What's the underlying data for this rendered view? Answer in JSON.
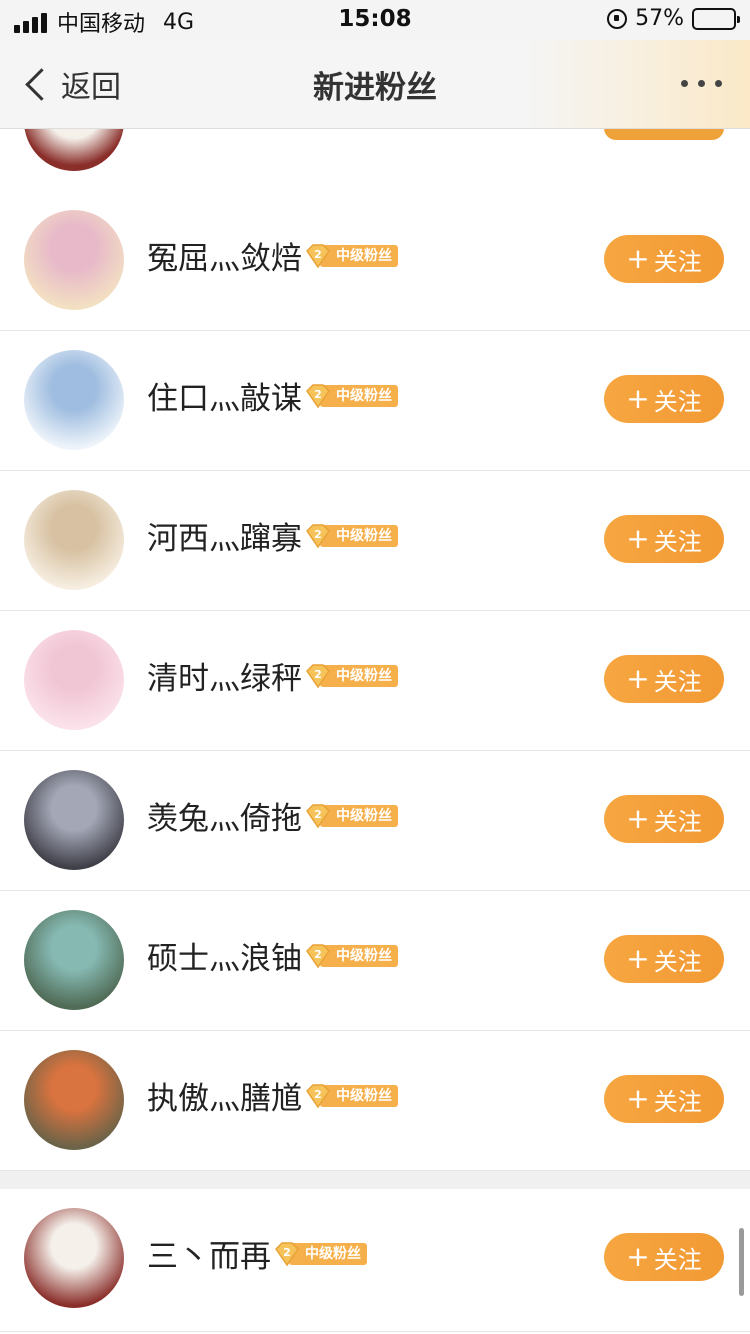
{
  "status_bar": {
    "carrier": "中国移动",
    "network": "4G",
    "time": "15:08",
    "battery": "57%",
    "battery_level": 0.57
  },
  "nav": {
    "back_label": "返回",
    "title": "新进粉丝",
    "more_icon": "more-icon"
  },
  "accent_color": "#f29a34",
  "badge": {
    "level": "2",
    "label": "中级粉丝"
  },
  "follow_label": "关注",
  "followers": [
    {
      "name": "冤屈灬敛焙",
      "avatar_colors": [
        "#f3e0c2",
        "#e7b9c9"
      ]
    },
    {
      "name": "住口灬敲谋",
      "avatar_colors": [
        "#eef4fa",
        "#9fbde0"
      ]
    },
    {
      "name": "河西灬蹿寡",
      "avatar_colors": [
        "#f6eee0",
        "#d7c1a2"
      ]
    },
    {
      "name": "清时灬绿秤",
      "avatar_colors": [
        "#fbe2ea",
        "#f1c6d4"
      ]
    },
    {
      "name": "羡兔灬倚拖",
      "avatar_colors": [
        "#3f3f48",
        "#a3a7b6"
      ]
    },
    {
      "name": "硕士灬浪铀",
      "avatar_colors": [
        "#4f6a55",
        "#86b9b2"
      ]
    },
    {
      "name": "执傲灬膳馗",
      "avatar_colors": [
        "#6b6348",
        "#d9733f"
      ]
    },
    {
      "name": "三丶而再",
      "avatar_colors": [
        "#8a2e2a",
        "#f5f0ea"
      ]
    }
  ]
}
